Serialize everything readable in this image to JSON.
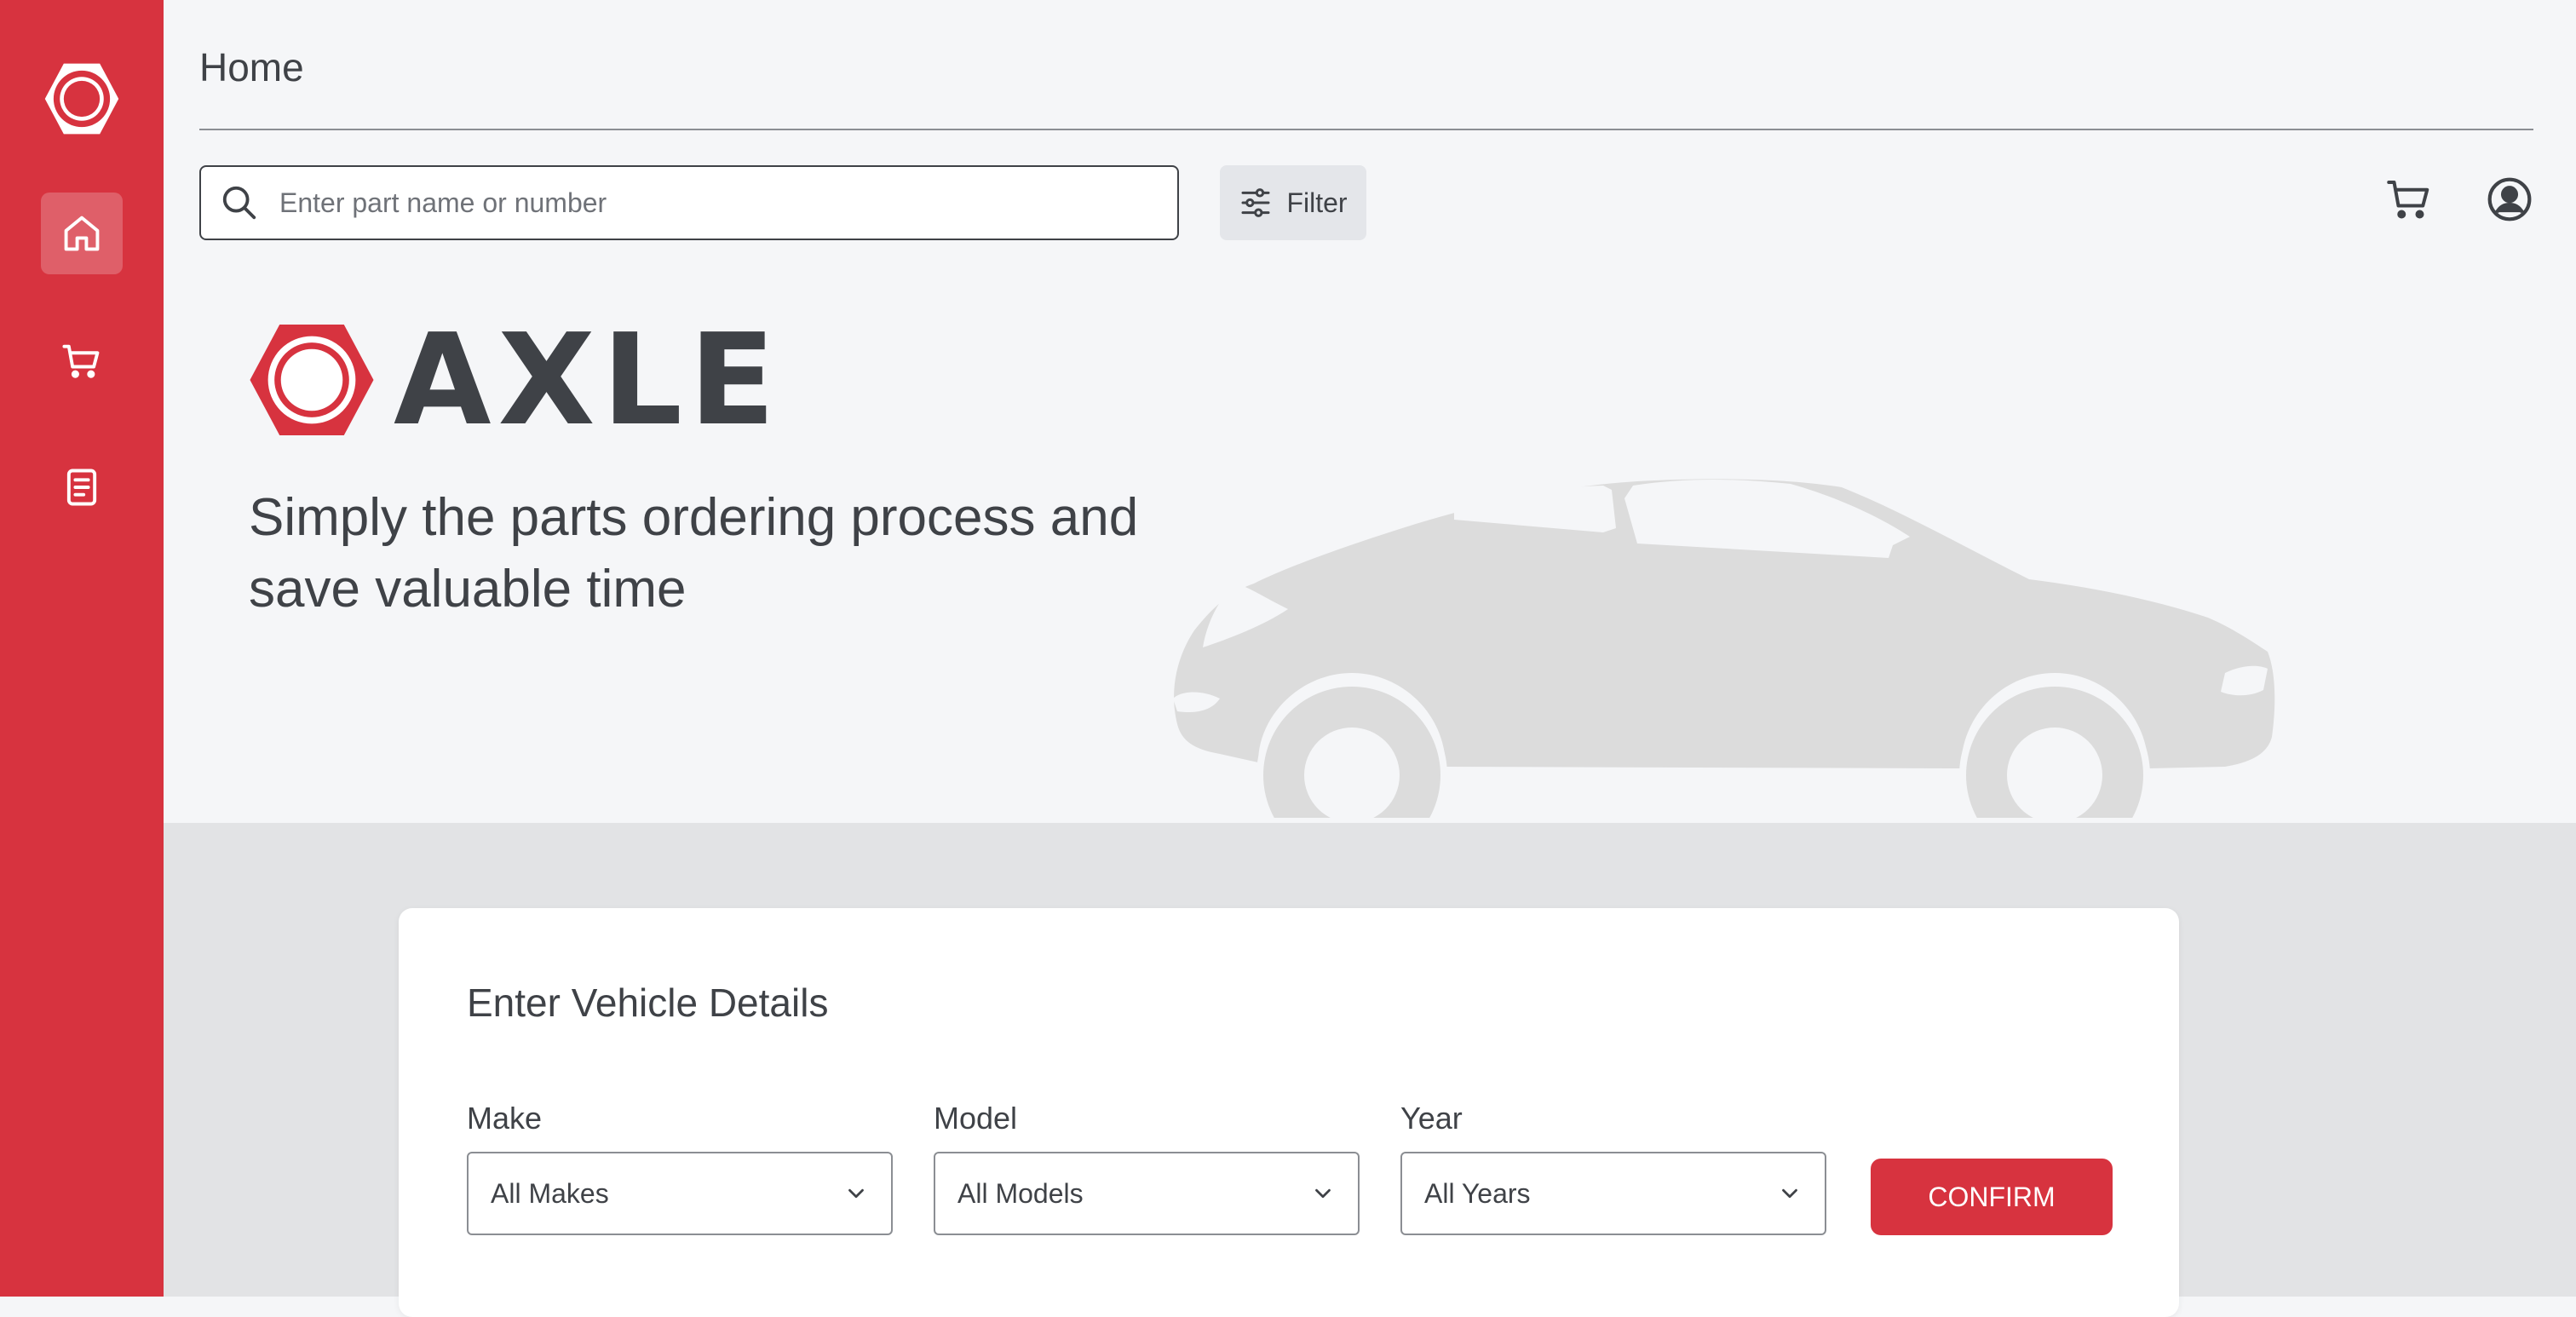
{
  "colors": {
    "brand_red": "#d7333f",
    "text_dark": "#3f4247",
    "background": "#f5f6f8",
    "car_silhouette": "#dcdcdc"
  },
  "sidebar": {
    "logo_icon": "hexagon-logo-icon",
    "items": [
      {
        "name": "home",
        "icon": "home-icon",
        "active": true
      },
      {
        "name": "cart",
        "icon": "cart-icon",
        "active": false
      },
      {
        "name": "orders",
        "icon": "document-icon",
        "active": false
      }
    ]
  },
  "header": {
    "title": "Home"
  },
  "search": {
    "placeholder": "Enter part name or number",
    "value": ""
  },
  "filter": {
    "label": "Filter"
  },
  "hero": {
    "brand": "AXLE",
    "tagline": "Simply the parts ordering process and save valuable time"
  },
  "vehicle_form": {
    "title": "Enter Vehicle Details",
    "make": {
      "label": "Make",
      "value": "All Makes"
    },
    "model": {
      "label": "Model",
      "value": "All Models"
    },
    "year": {
      "label": "Year",
      "value": "All Years"
    },
    "confirm_label": "CONFIRM"
  }
}
